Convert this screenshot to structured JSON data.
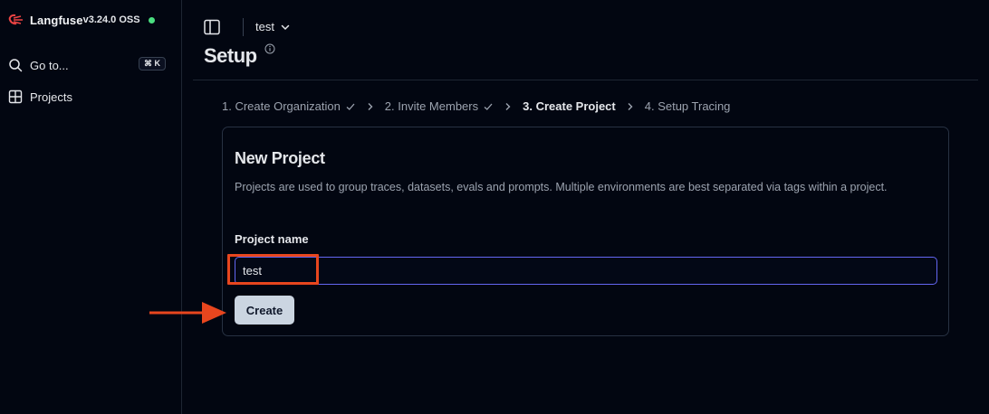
{
  "sidebar": {
    "brand_name": "Langfuse",
    "brand_version": "v3.24.0 OSS",
    "status_color": "#4ade80",
    "goto_label": "Go to...",
    "goto_shortcut": "⌘ K",
    "projects_label": "Projects"
  },
  "header": {
    "project_switcher": "test",
    "page_title": "Setup"
  },
  "steps": [
    {
      "label": "1. Create Organization",
      "done": true
    },
    {
      "label": "2. Invite Members",
      "done": true
    },
    {
      "label": "3. Create Project",
      "active": true
    },
    {
      "label": "4. Setup Tracing"
    }
  ],
  "card": {
    "title": "New Project",
    "description": "Projects are used to group traces, datasets, evals and prompts. Multiple environments are best separated via tags within a project.",
    "field_label": "Project name",
    "input_value": "test",
    "create_label": "Create"
  },
  "annotations": {
    "color": "#e8461e"
  }
}
